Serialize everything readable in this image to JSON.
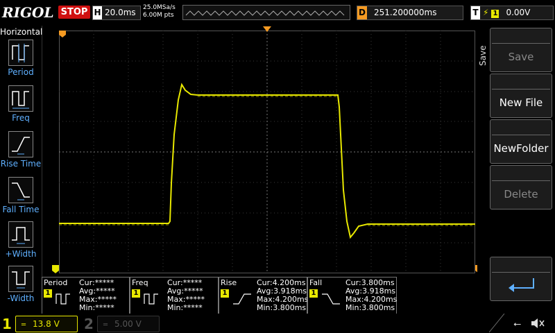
{
  "header": {
    "brand": "RIGOL",
    "run_state": "STOP",
    "timebase_tag": "H",
    "timebase": "20.0ms",
    "sample_rate": "25.0MSa/s",
    "memory_depth": "6.00M pts",
    "delay_tag": "D",
    "delay": "251.200000ms",
    "trigger_tag": "T",
    "trigger_channel": "1",
    "trigger_level": "0.00V"
  },
  "left_menu": {
    "title": "Horizontal",
    "items": [
      {
        "label": "Period",
        "icon": "period-icon"
      },
      {
        "label": "Freq",
        "icon": "frequency-icon"
      },
      {
        "label": "Rise Time",
        "icon": "rise-time-icon"
      },
      {
        "label": "Fall Time",
        "icon": "fall-time-icon"
      },
      {
        "label": "+Width",
        "icon": "positive-width-icon"
      },
      {
        "label": "-Width",
        "icon": "negative-width-icon"
      }
    ]
  },
  "right_menu": {
    "tab": "Save",
    "buttons": [
      {
        "label": "Save",
        "enabled": false
      },
      {
        "label": "New File",
        "enabled": true
      },
      {
        "label": "NewFolder",
        "enabled": true
      },
      {
        "label": "Delete",
        "enabled": false
      }
    ],
    "back_icon": "return-arrow-icon"
  },
  "measurements": [
    {
      "name": "Period",
      "channel": "1",
      "icon": "period-icon",
      "cur": "Cur:*****",
      "avg": "Avg:*****",
      "max": "Max:*****",
      "min": "Min:*****"
    },
    {
      "name": "Freq",
      "channel": "1",
      "icon": "frequency-icon",
      "cur": "Cur:*****",
      "avg": "Avg:*****",
      "max": "Max:*****",
      "min": "Min:*****"
    },
    {
      "name": "Rise",
      "channel": "1",
      "icon": "rise-time-icon",
      "cur": "Cur:4.200ms",
      "avg": "Avg:3.918ms",
      "max": "Max:4.200ms",
      "min": "Min:3.800ms"
    },
    {
      "name": "Fall",
      "channel": "1",
      "icon": "fall-time-icon",
      "cur": "Cur:3.800ms",
      "avg": "Avg:3.918ms",
      "max": "Max:4.200ms",
      "min": "Min:3.800ms"
    }
  ],
  "channels": [
    {
      "num": "1",
      "scale": "13.8 V",
      "active": true
    },
    {
      "num": "2",
      "scale": "5.00 V",
      "active": false
    }
  ],
  "colors": {
    "ch1": "#e8e800",
    "trigger_marker": "#f59a22",
    "stop": "#d01010",
    "label_blue": "#5fb0ff"
  },
  "status_icons": [
    "usb-icon",
    "mute-icon"
  ]
}
